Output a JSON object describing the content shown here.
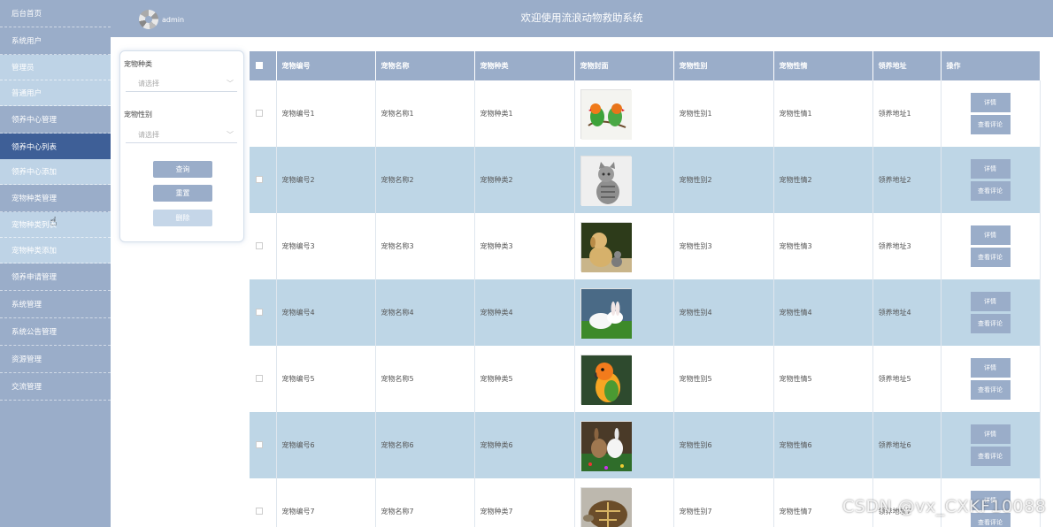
{
  "header": {
    "title": "欢迎使用流浪动物救助系统",
    "username": "admin"
  },
  "sidebar": {
    "items": [
      {
        "label": "后台首页",
        "kind": "group"
      },
      {
        "label": "系统用户",
        "kind": "group"
      },
      {
        "label": "管理员",
        "kind": "sub"
      },
      {
        "label": "普通用户",
        "kind": "sub"
      },
      {
        "label": "领养中心管理",
        "kind": "group"
      },
      {
        "label": "领养中心列表",
        "kind": "active"
      },
      {
        "label": "领养中心添加",
        "kind": "sub"
      },
      {
        "label": "宠物种类管理",
        "kind": "group"
      },
      {
        "label": "宠物种类列表",
        "kind": "sub"
      },
      {
        "label": "宠物种类添加",
        "kind": "sub"
      },
      {
        "label": "领养申请管理",
        "kind": "group"
      },
      {
        "label": "系统管理",
        "kind": "group"
      },
      {
        "label": "系统公告管理",
        "kind": "group"
      },
      {
        "label": "资源管理",
        "kind": "group"
      },
      {
        "label": "交流管理",
        "kind": "group"
      }
    ]
  },
  "filter": {
    "type_label": "宠物种类",
    "type_placeholder": "请选择",
    "gender_label": "宠物性别",
    "gender_placeholder": "请选择",
    "query_button": "查询",
    "reset_button": "重置",
    "delete_button": "删除"
  },
  "table": {
    "columns": [
      "宠物编号",
      "宠物名称",
      "宠物种类",
      "宠物封面",
      "宠物性别",
      "宠物性情",
      "领养地址",
      "操作"
    ],
    "detail_label": "详情",
    "comment_label": "查看评论",
    "rows": [
      {
        "id": "宠物编号1",
        "name": "宠物名称1",
        "type": "宠物种类1",
        "image": "lovebirds",
        "gender": "宠物性别1",
        "temper": "宠物性情1",
        "address": "领养地址1"
      },
      {
        "id": "宠物编号2",
        "name": "宠物名称2",
        "type": "宠物种类2",
        "image": "tabby-cat",
        "gender": "宠物性别2",
        "temper": "宠物性情2",
        "address": "领养地址2"
      },
      {
        "id": "宠物编号3",
        "name": "宠物名称3",
        "type": "宠物种类3",
        "image": "puppy-and-kitten",
        "gender": "宠物性别3",
        "temper": "宠物性情3",
        "address": "领养地址3"
      },
      {
        "id": "宠物编号4",
        "name": "宠物名称4",
        "type": "宠物种类4",
        "image": "white-rabbits",
        "gender": "宠物性别4",
        "temper": "宠物性情4",
        "address": "领养地址4"
      },
      {
        "id": "宠物编号5",
        "name": "宠物名称5",
        "type": "宠物种类5",
        "image": "conure-parrot",
        "gender": "宠物性别5",
        "temper": "宠物性情5",
        "address": "领养地址5"
      },
      {
        "id": "宠物编号6",
        "name": "宠物名称6",
        "type": "宠物种类6",
        "image": "rabbits-in-grass",
        "gender": "宠物性别6",
        "temper": "宠物性情6",
        "address": "领养地址6"
      },
      {
        "id": "宠物编号7",
        "name": "宠物名称7",
        "type": "宠物种类7",
        "image": "tortoise",
        "gender": "宠物性别7",
        "temper": "宠物性情7",
        "address": "领养地址7"
      }
    ]
  },
  "watermark": "CSDN @vx_CXKF10088",
  "colors": {
    "sidebar": "#9aadc9",
    "active": "#3e5f97",
    "row_alt": "#bed6e6",
    "sub_item": "#bed3e6"
  }
}
